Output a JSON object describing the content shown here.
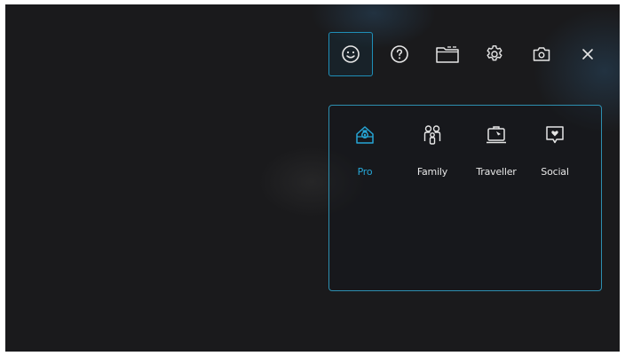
{
  "toolbar": {
    "items": [
      {
        "icon": "smiley-icon",
        "active": true
      },
      {
        "icon": "help-icon",
        "active": false
      },
      {
        "icon": "folder-icon",
        "active": false
      },
      {
        "icon": "gear-icon",
        "active": false
      },
      {
        "icon": "camera-icon",
        "active": false
      },
      {
        "icon": "close-icon",
        "active": false
      }
    ]
  },
  "modes": {
    "selected": "Pro",
    "items": [
      {
        "label": "Pro",
        "icon": "pro-icon"
      },
      {
        "label": "Family",
        "icon": "family-icon"
      },
      {
        "label": "Traveller",
        "icon": "traveller-icon"
      },
      {
        "label": "Social",
        "icon": "social-icon"
      }
    ]
  },
  "colors": {
    "accent": "#26a6d6",
    "background": "#1a1a1c",
    "icon": "#e6e6e6"
  }
}
